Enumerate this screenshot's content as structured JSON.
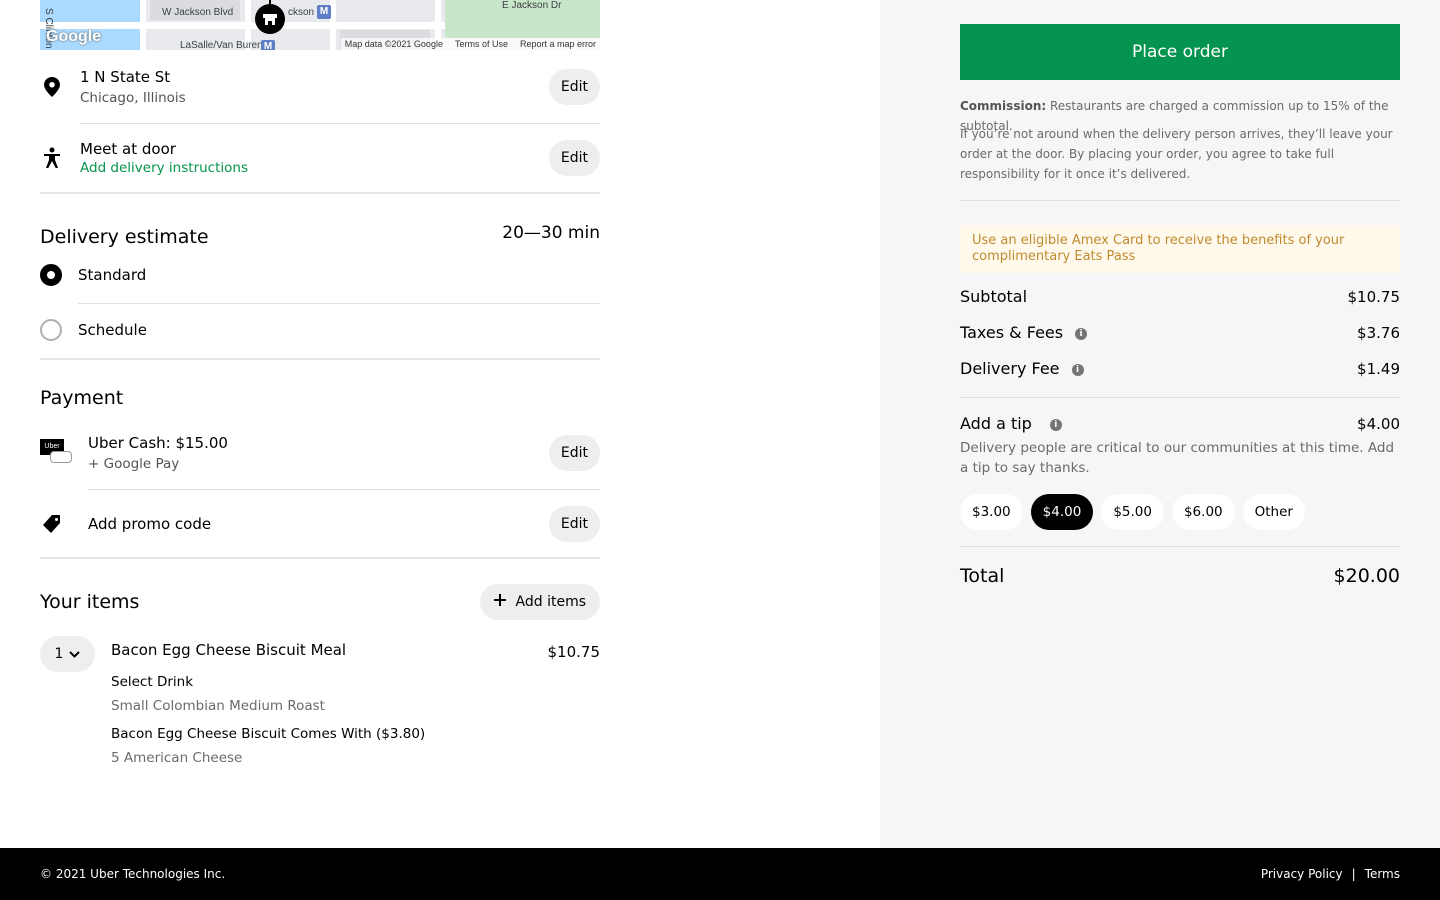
{
  "map": {
    "labels": [
      "W Jackson Blvd",
      "ckson",
      "E Jackson Dr",
      "S Clinton",
      "LaSalle/Van Buren"
    ],
    "metro_letter": "M",
    "google_logo": "Google",
    "attribution": [
      "Map data ©2021 Google",
      "Terms of Use",
      "Report a map error"
    ]
  },
  "address": {
    "line1": "1 N State St",
    "line2": "Chicago, Illinois",
    "edit_label": "Edit"
  },
  "dropoff": {
    "title": "Meet at door",
    "instructions_link": "Add delivery instructions",
    "edit_label": "Edit"
  },
  "delivery": {
    "heading": "Delivery estimate",
    "estimate": "20—30 min",
    "options": [
      {
        "label": "Standard",
        "selected": true
      },
      {
        "label": "Schedule",
        "selected": false
      }
    ]
  },
  "payment": {
    "heading": "Payment",
    "method_title": "Uber Cash: $15.00",
    "method_sub": "+ Google Pay",
    "card_brand": "Uber",
    "edit_label": "Edit",
    "promo_label": "Add promo code",
    "promo_edit_label": "Edit"
  },
  "items": {
    "heading": "Your items",
    "add_label": "Add items",
    "list": [
      {
        "qty": "1",
        "name": "Bacon Egg Cheese Biscuit Meal",
        "price": "$10.75",
        "options": [
          {
            "group": "Select Drink",
            "choice": "Small Colombian Medium Roast"
          },
          {
            "group": "Bacon Egg Cheese Biscuit Comes With ($3.80)",
            "choice": "5 American Cheese"
          }
        ]
      }
    ]
  },
  "checkout": {
    "place_order": "Place order",
    "commission_label": "Commission:",
    "commission_text": " Restaurants are charged a commission up to 15% of the subtotal.",
    "disclaimer": "If you’re not around when the delivery person arrives, they’ll leave your order at the door. By placing your order, you agree to take full responsibility for it once it’s delivered.",
    "amex_promo": "Use an eligible Amex Card to receive the benefits of your complimentary Eats Pass",
    "subtotal_label": "Subtotal",
    "subtotal": "$10.75",
    "taxes_label": "Taxes & Fees",
    "taxes": "$3.76",
    "delivery_fee_label": "Delivery Fee",
    "delivery_fee": "$1.49",
    "tip_label": "Add a tip",
    "tip": "$4.00",
    "tip_note": "Delivery people are critical to our communities at this time. Add a tip to say thanks.",
    "tip_options": [
      "$3.00",
      "$4.00",
      "$5.00",
      "$6.00",
      "Other"
    ],
    "tip_selected": "$4.00",
    "total_label": "Total",
    "total": "$20.00",
    "accent_color": "#05944f"
  },
  "footer": {
    "copyright": "© 2021 Uber Technologies Inc.",
    "privacy": "Privacy Policy",
    "separator": "|",
    "terms": "Terms"
  }
}
